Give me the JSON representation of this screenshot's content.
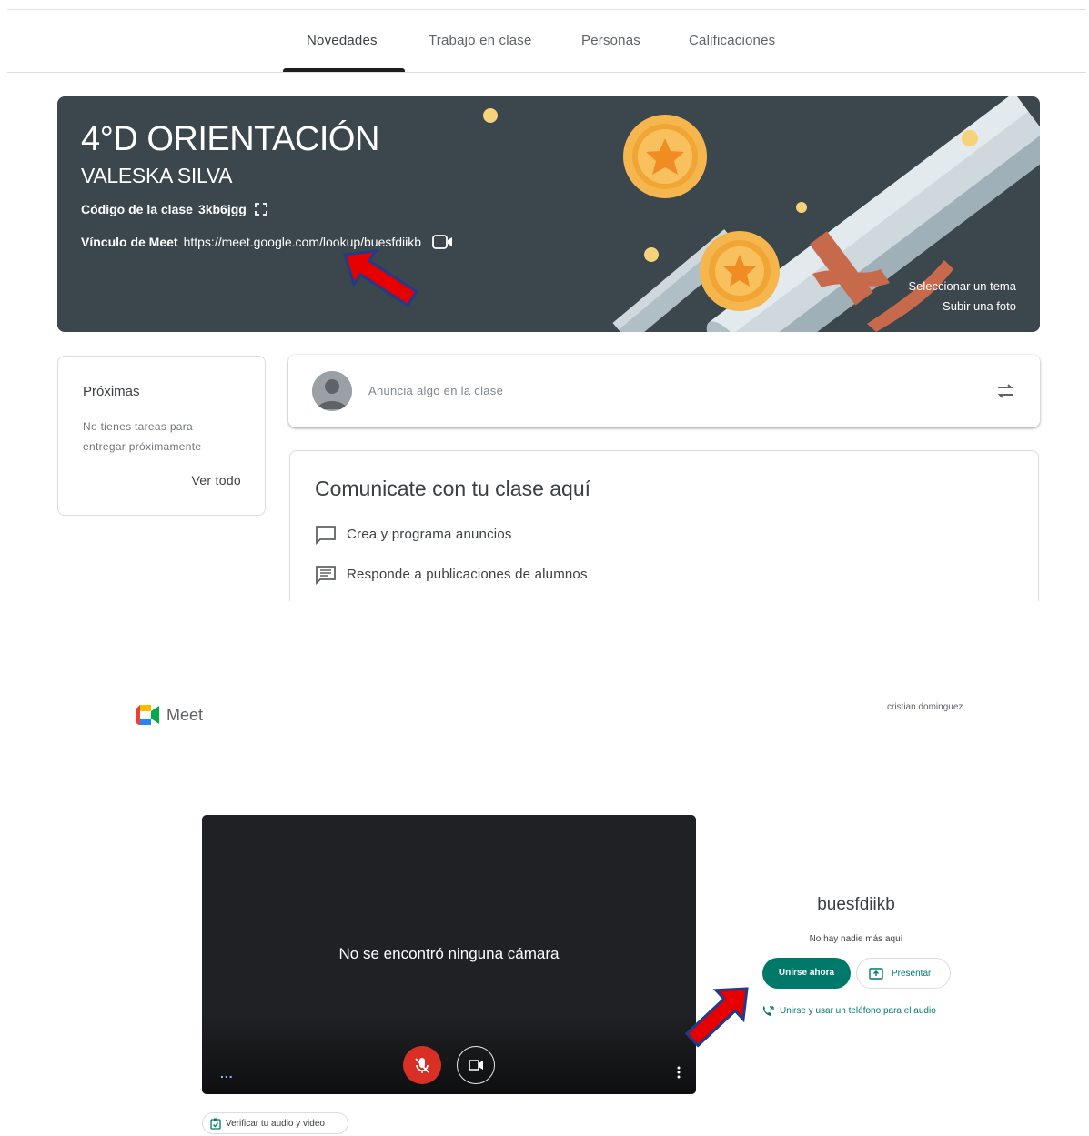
{
  "classroom": {
    "tabs": [
      {
        "label": "Novedades",
        "active": true
      },
      {
        "label": "Trabajo en clase",
        "active": false
      },
      {
        "label": "Personas",
        "active": false
      },
      {
        "label": "Calificaciones",
        "active": false
      }
    ],
    "banner": {
      "title": "4°D ORIENTACIÓN",
      "teacher": "VALESKA SILVA",
      "code_label": "Código de la clase",
      "code_value": "3kb6jgg",
      "meet_label": "Vínculo de Meet",
      "meet_url": "https://meet.google.com/lookup/buesfdiikb",
      "select_theme": "Seleccionar un tema",
      "upload_photo": "Subir una foto"
    },
    "upcoming": {
      "title": "Próximas",
      "empty_text": "No tienes tareas para entregar próximamente",
      "view_all": "Ver todo"
    },
    "announce": {
      "placeholder": "Anuncia algo en la clase"
    },
    "communicate": {
      "title": "Comunicate con tu clase aquí",
      "items": [
        {
          "label": "Crea y programa anuncios",
          "icon": "chat-bubble-icon"
        },
        {
          "label": "Responde a publicaciones de alumnos",
          "icon": "comment-list-icon"
        }
      ]
    }
  },
  "meet": {
    "app_name": "Meet",
    "account": "cristian.dominguez",
    "video": {
      "no_camera": "No se encontró ninguna cámara",
      "dots": "..."
    },
    "meeting_code": "buesfdiikb",
    "status": "No hay nadie más aquí",
    "join_label": "Unirse ahora",
    "present_label": "Presentar",
    "phone_label": "Unirse y usar un teléfono para el audio",
    "check_label": "Verificar tu audio y video"
  },
  "colors": {
    "banner_bg": "#3b464d",
    "meet_green": "#00796b",
    "mic_red": "#d93025",
    "arrow_red": "#e60000",
    "arrow_outline": "#1f3c88"
  }
}
